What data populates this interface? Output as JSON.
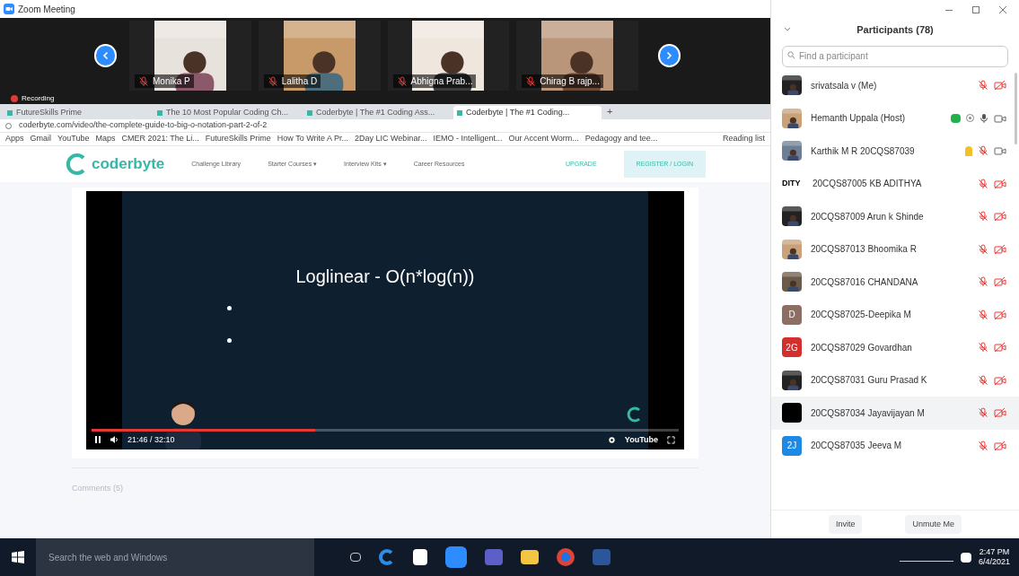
{
  "window": {
    "title": "Zoom Meeting"
  },
  "thumbnails": [
    {
      "name": "Monika P",
      "muted": true
    },
    {
      "name": "Lalitha D",
      "muted": true
    },
    {
      "name": "Abhigna Prab...",
      "muted": true
    },
    {
      "name": "Chirag B rajp...",
      "muted": true
    }
  ],
  "recording": {
    "label": "Recording"
  },
  "browser": {
    "tabs": [
      {
        "title": "FutureSkills Prime",
        "selected": false
      },
      {
        "title": "The 10 Most Popular Coding Ch...",
        "selected": false
      },
      {
        "title": "Coderbyte | The #1 Coding Ass...",
        "selected": false
      },
      {
        "title": "Coderbyte | The #1 Coding...",
        "selected": true
      }
    ],
    "url": "coderbyte.com/video/the-complete-guide-to-big-o-notation-part-2-of-2",
    "bookmarks": [
      "Apps",
      "Gmail",
      "YouTube",
      "Maps",
      "CMER 2021: The Li...",
      "FutureSkills Prime",
      "How To Write A Pr...",
      "2Day LIC Webinar...",
      "IEMO - Intelligent...",
      "Our Accent Worm...",
      "Pedagogy and tee..."
    ],
    "new_tab": "+",
    "reading_list": "Reading list"
  },
  "site": {
    "logo": "coderbyte",
    "nav": [
      "Challenge Library",
      "Starter Courses ▾",
      "Interview Kits ▾",
      "Career Resources"
    ],
    "upgrade": "UPGRADE",
    "register": "REGISTER / LOGIN"
  },
  "video": {
    "slide_title": "Loglinear - O(n*log(n))",
    "level": 0.38,
    "time": "21:46 / 32:10",
    "brand": "YouTube"
  },
  "comments": "Comments (5)",
  "participants": {
    "title": "Participants (78)",
    "search_placeholder": "Find a participant",
    "rows": [
      {
        "name": "srivatsala v (Me)",
        "muted": true,
        "video_on": false,
        "hand_raised": false,
        "sharing": false,
        "selected": false
      },
      {
        "name": "Hemanth Uppala (Host)",
        "muted": false,
        "video_on": true,
        "hand_raised": false,
        "sharing": true,
        "selected": false
      },
      {
        "name": "Karthik M R 20CQS87039",
        "muted": true,
        "video_on": true,
        "hand_raised": true,
        "sharing": false,
        "selected": false
      },
      {
        "name": "20CQS87005 KB ADITHYA",
        "kind": "text",
        "avatar_text": "DITY",
        "muted": true,
        "video_on": false,
        "hand_raised": false,
        "sharing": false,
        "selected": false
      },
      {
        "name": "20CQS87009 Arun k Shinde",
        "muted": true,
        "video_on": false,
        "hand_raised": false,
        "sharing": false,
        "selected": false
      },
      {
        "name": "20CQS87013 Bhoomika R",
        "muted": true,
        "video_on": false,
        "hand_raised": false,
        "sharing": false,
        "selected": false
      },
      {
        "name": "20CQS87016 CHANDANA",
        "muted": true,
        "video_on": false,
        "hand_raised": false,
        "sharing": false,
        "selected": false
      },
      {
        "name": "20CQS87025-Deepika M",
        "kind": "letter",
        "avatar_text": "D",
        "color": "#8d6e63",
        "muted": true,
        "video_on": false,
        "hand_raised": false,
        "sharing": false,
        "selected": false
      },
      {
        "name": "20CQS87029 Govardhan",
        "kind": "letter",
        "avatar_text": "2G",
        "color": "#d32f2f",
        "muted": true,
        "video_on": false,
        "hand_raised": false,
        "sharing": false,
        "selected": false
      },
      {
        "name": "20CQS87031 Guru Prasad K",
        "muted": true,
        "video_on": false,
        "hand_raised": false,
        "sharing": false,
        "selected": false
      },
      {
        "name": "20CQS87034 Jayavijayan M",
        "kind": "blank",
        "color": "#000000",
        "muted": true,
        "video_on": false,
        "hand_raised": false,
        "sharing": false,
        "selected": true
      },
      {
        "name": "20CQS87035 Jeeva M",
        "kind": "letter",
        "avatar_text": "2J",
        "color": "#1e88e5",
        "muted": true,
        "video_on": false,
        "hand_raised": false,
        "sharing": false,
        "selected": false
      }
    ],
    "buttons": [
      "Invite",
      "Unmute Me"
    ]
  },
  "taskbar": {
    "search_placeholder": "Search the web and Windows",
    "time": "2:47 PM",
    "date": "6/4/2021"
  }
}
